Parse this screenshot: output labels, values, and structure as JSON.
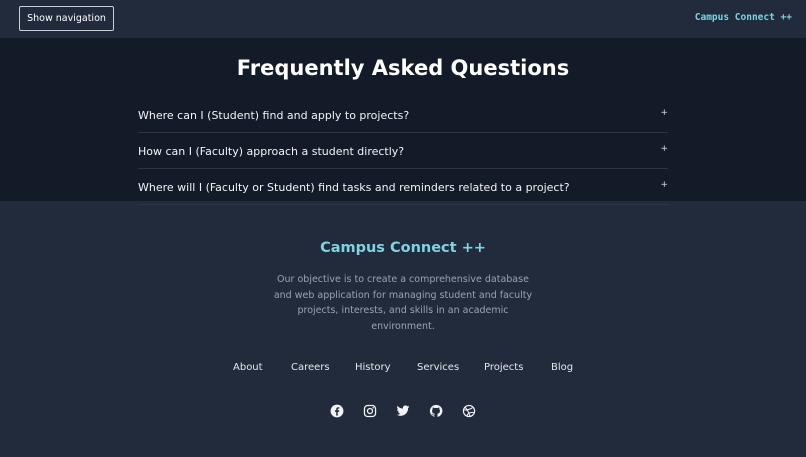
{
  "header": {
    "nav_button_label": "Show navigation",
    "brand": "Campus Connect ++"
  },
  "faq": {
    "title": "Frequently Asked Questions",
    "items": [
      {
        "question": "Where can I (Student) find and apply to projects?",
        "toggle": "+"
      },
      {
        "question": "How can I (Faculty) approach a student directly?",
        "toggle": "+"
      },
      {
        "question": "Where will I (Faculty or Student) find tasks and reminders related to a project?",
        "toggle": "+"
      }
    ]
  },
  "footer": {
    "brand": "Campus Connect ++",
    "description": "Our objective is to create a comprehensive database and web application for managing student and faculty projects, interests, and skills in an academic environment.",
    "links": [
      "About",
      "Careers",
      "History",
      "Services",
      "Projects",
      "Blog"
    ],
    "social_icons": [
      "facebook-icon",
      "instagram-icon",
      "twitter-icon",
      "github-icon",
      "dribbble-icon"
    ]
  },
  "colors": {
    "accent": "#7fd3e1",
    "background": "#222b3b",
    "faq_background": "#131a28"
  }
}
